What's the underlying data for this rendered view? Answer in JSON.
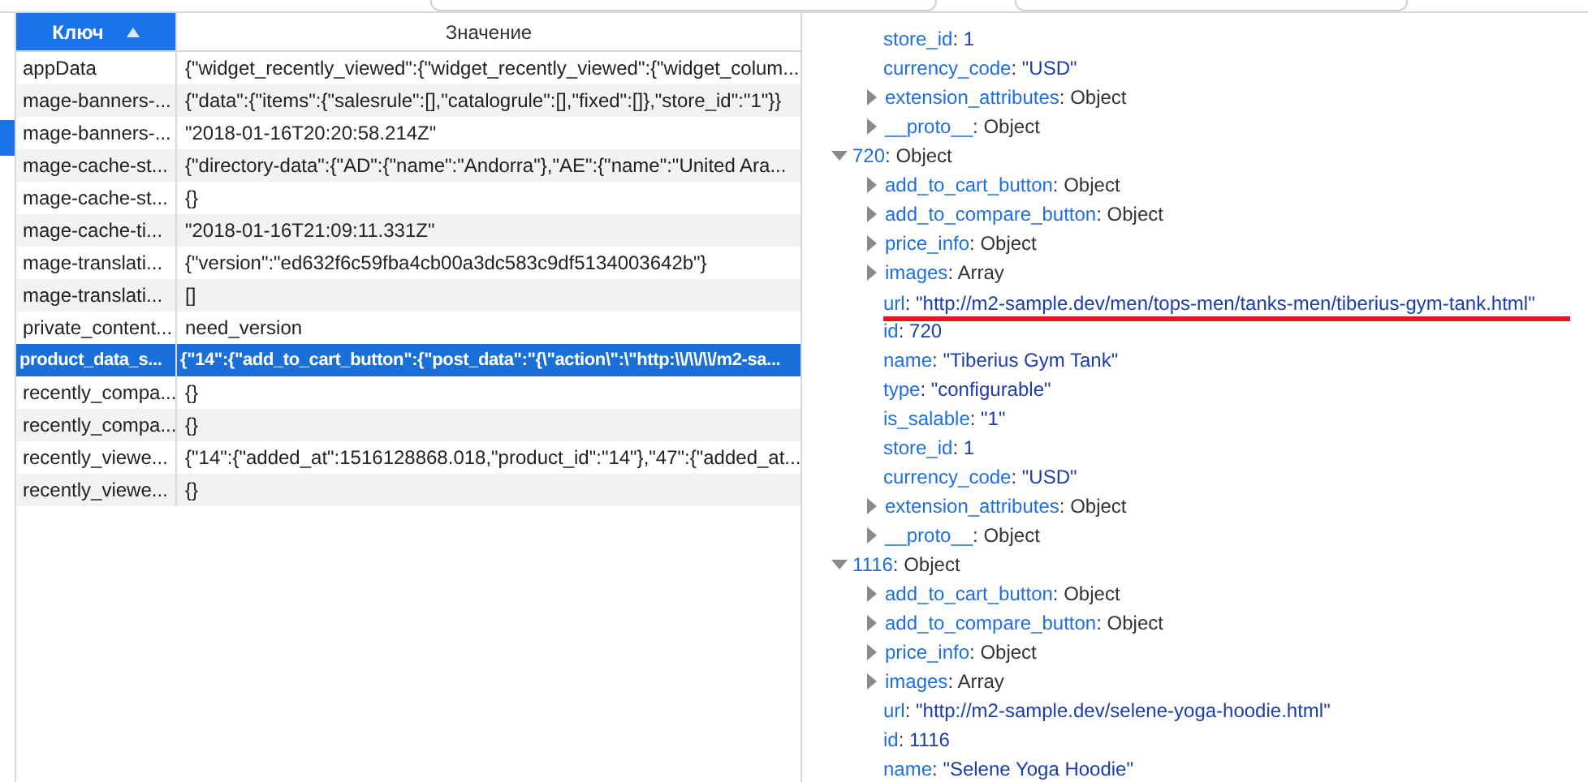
{
  "table": {
    "columns": [
      {
        "label": "Ключ",
        "sorted": true
      },
      {
        "label": "Значение",
        "sorted": false
      }
    ],
    "rows": [
      {
        "key": "appData",
        "value": "{\"widget_recently_viewed\":{\"widget_recently_viewed\":{\"widget_colum...",
        "selected": false
      },
      {
        "key": "mage-banners-...",
        "value": "{\"data\":{\"items\":{\"salesrule\":[],\"catalogrule\":[],\"fixed\":[]},\"store_id\":\"1\"}}",
        "selected": false
      },
      {
        "key": "mage-banners-...",
        "value": "\"2018-01-16T20:20:58.214Z\"",
        "selected": false
      },
      {
        "key": "mage-cache-st...",
        "value": "{\"directory-data\":{\"AD\":{\"name\":\"Andorra\"},\"AE\":{\"name\":\"United Ara...",
        "selected": false
      },
      {
        "key": "mage-cache-st...",
        "value": "{}",
        "selected": false
      },
      {
        "key": "mage-cache-ti...",
        "value": "\"2018-01-16T21:09:11.331Z\"",
        "selected": false
      },
      {
        "key": "mage-translati...",
        "value": "{\"version\":\"ed632f6c59fba4cb00a3dc583c9df5134003642b\"}",
        "selected": false
      },
      {
        "key": "mage-translati...",
        "value": "[]",
        "selected": false
      },
      {
        "key": "private_content...",
        "value": "need_version",
        "selected": false
      },
      {
        "key": "product_data_s...",
        "value": "{\"14\":{\"add_to_cart_button\":{\"post_data\":\"{\\\"action\\\":\\\"http:\\\\/\\\\/\\\\/m2-sa...",
        "selected": true
      },
      {
        "key": "recently_compa...",
        "value": "{}",
        "selected": false
      },
      {
        "key": "recently_compa...",
        "value": "{}",
        "selected": false
      },
      {
        "key": "recently_viewe...",
        "value": "{\"14\":{\"added_at\":1516128868.018,\"product_id\":\"14\"},\"47\":{\"added_at...",
        "selected": false
      },
      {
        "key": "recently_viewe...",
        "value": "{}",
        "selected": false
      }
    ]
  },
  "tree": {
    "separator": ":",
    "continued_children": [
      {
        "key": "store_id",
        "value": "1",
        "kind": "primitive"
      },
      {
        "key": "currency_code",
        "value": "\"USD\"",
        "kind": "primitive"
      },
      {
        "key": "extension_attributes",
        "value": "Object",
        "kind": "expandable",
        "expanded": false
      },
      {
        "key": "__proto__",
        "value": "Object",
        "kind": "expandable",
        "expanded": false
      }
    ],
    "nodes": [
      {
        "key": "720",
        "value": "Object",
        "kind": "expandable",
        "expanded": true,
        "children": [
          {
            "key": "add_to_cart_button",
            "value": "Object",
            "kind": "expandable",
            "expanded": false
          },
          {
            "key": "add_to_compare_button",
            "value": "Object",
            "kind": "expandable",
            "expanded": false
          },
          {
            "key": "price_info",
            "value": "Object",
            "kind": "expandable",
            "expanded": false
          },
          {
            "key": "images",
            "value": "Array",
            "kind": "expandable",
            "expanded": false
          },
          {
            "key": "url",
            "value": "\"http://m2-sample.dev/men/tops-men/tanks-men/tiberius-gym-tank.html\"",
            "kind": "primitive",
            "underlined": true
          },
          {
            "key": "id",
            "value": "720",
            "kind": "primitive"
          },
          {
            "key": "name",
            "value": "\"Tiberius Gym Tank\"",
            "kind": "primitive"
          },
          {
            "key": "type",
            "value": "\"configurable\"",
            "kind": "primitive"
          },
          {
            "key": "is_salable",
            "value": "\"1\"",
            "kind": "primitive"
          },
          {
            "key": "store_id",
            "value": "1",
            "kind": "primitive"
          },
          {
            "key": "currency_code",
            "value": "\"USD\"",
            "kind": "primitive"
          },
          {
            "key": "extension_attributes",
            "value": "Object",
            "kind": "expandable",
            "expanded": false
          },
          {
            "key": "__proto__",
            "value": "Object",
            "kind": "expandable",
            "expanded": false
          }
        ]
      },
      {
        "key": "1116",
        "value": "Object",
        "kind": "expandable",
        "expanded": true,
        "children": [
          {
            "key": "add_to_cart_button",
            "value": "Object",
            "kind": "expandable",
            "expanded": false
          },
          {
            "key": "add_to_compare_button",
            "value": "Object",
            "kind": "expandable",
            "expanded": false
          },
          {
            "key": "price_info",
            "value": "Object",
            "kind": "expandable",
            "expanded": false
          },
          {
            "key": "images",
            "value": "Array",
            "kind": "expandable",
            "expanded": false
          },
          {
            "key": "url",
            "value": "\"http://m2-sample.dev/selene-yoga-hoodie.html\"",
            "kind": "primitive"
          },
          {
            "key": "id",
            "value": "1116",
            "kind": "primitive"
          },
          {
            "key": "name",
            "value": "\"Selene Yoga Hoodie\"",
            "kind": "primitive"
          }
        ]
      }
    ]
  }
}
